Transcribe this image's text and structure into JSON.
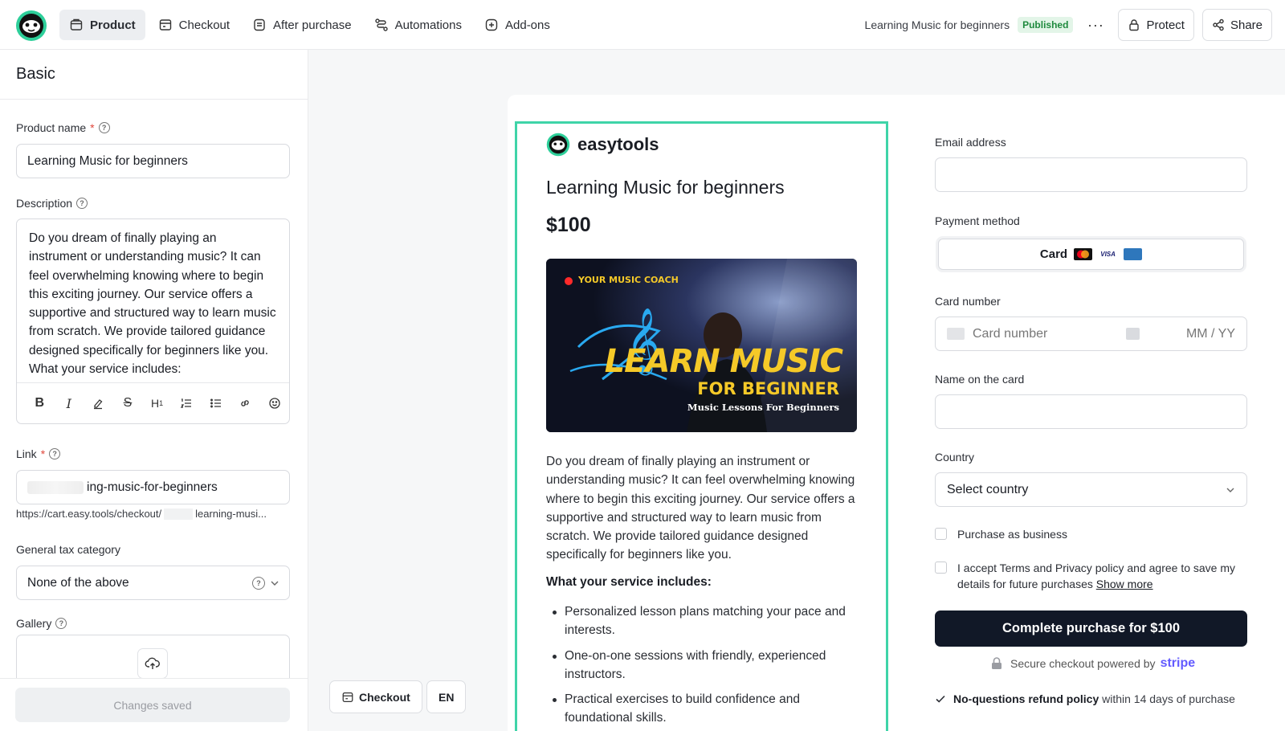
{
  "nav": {
    "items": [
      {
        "label": "Product",
        "icon": "box-icon",
        "active": true
      },
      {
        "label": "Checkout",
        "icon": "checkout-icon"
      },
      {
        "label": "After purchase",
        "icon": "receipt-icon"
      },
      {
        "label": "Automations",
        "icon": "flow-icon"
      },
      {
        "label": "Add-ons",
        "icon": "add-icon"
      }
    ],
    "product_name": "Learning Music for beginners",
    "status_badge": "Published",
    "more": "···",
    "protect_label": "Protect",
    "share_label": "Share"
  },
  "editor": {
    "section_title": "Basic",
    "product_name_label": "Product name",
    "product_name_value": "Learning Music for beginners",
    "description_label": "Description",
    "description_text": "Do you dream of finally playing an instrument or understanding music? It can feel overwhelming knowing where to begin this exciting journey. Our service offers a supportive and structured way to learn music from scratch. We provide tailored guidance designed specifically for beginners like you.",
    "description_next": "What your service includes:",
    "link_label": "Link",
    "link_value": "ing-music-for-beginners",
    "link_url_prefix": "https://cart.easy.tools/checkout/",
    "link_url_suffix": "learning-musi...",
    "tax_label": "General tax category",
    "tax_value": "None of the above",
    "gallery_label": "Gallery",
    "save_status": "Changes saved",
    "required_mark": "*"
  },
  "preview": {
    "brand": "easytools",
    "title": "Learning Music for beginners",
    "price": "$100",
    "banner": {
      "tag": "YOUR MUSIC COACH",
      "headline": "LEARN MUSIC",
      "subheadline": "FOR BEGINNER",
      "caption": "Music Lessons For Beginners"
    },
    "description": "Do you dream of finally playing an instrument or understanding music? It can feel overwhelming knowing where to begin this exciting journey. Our service offers a supportive and structured way to learn music from scratch. We provide tailored guidance designed specifically for beginners like you.",
    "includes_title": "What your service includes:",
    "includes": [
      "Personalized lesson plans matching your pace and interests.",
      "One-on-one sessions with friendly, experienced instructors.",
      "Practical exercises to build confidence and foundational skills."
    ],
    "checkout_button": "Checkout",
    "language_button": "EN"
  },
  "checkout": {
    "email_label": "Email address",
    "payment_label": "Payment method",
    "payment_value": "Card",
    "card_label": "Card number",
    "card_placeholder": "Card number",
    "expiry_placeholder": "MM / YY",
    "name_label": "Name on the card",
    "country_label": "Country",
    "country_value": "Select country",
    "business_label": "Purchase as business",
    "terms_label": "I accept Terms and Privacy policy and agree to save my details for future purchases",
    "show_more": "Show more",
    "buy_label": "Complete purchase for $100",
    "secure_text": "Secure checkout powered by",
    "stripe": "stripe",
    "refund_bold": "No-questions refund policy",
    "refund_rest": "within 14 days of purchase"
  },
  "colors": {
    "accent_outline": "#3fd4a8",
    "buy_button": "#111827",
    "badge_bg": "#e3f5e8",
    "badge_text": "#1f8a3e",
    "stripe": "#635bff"
  }
}
